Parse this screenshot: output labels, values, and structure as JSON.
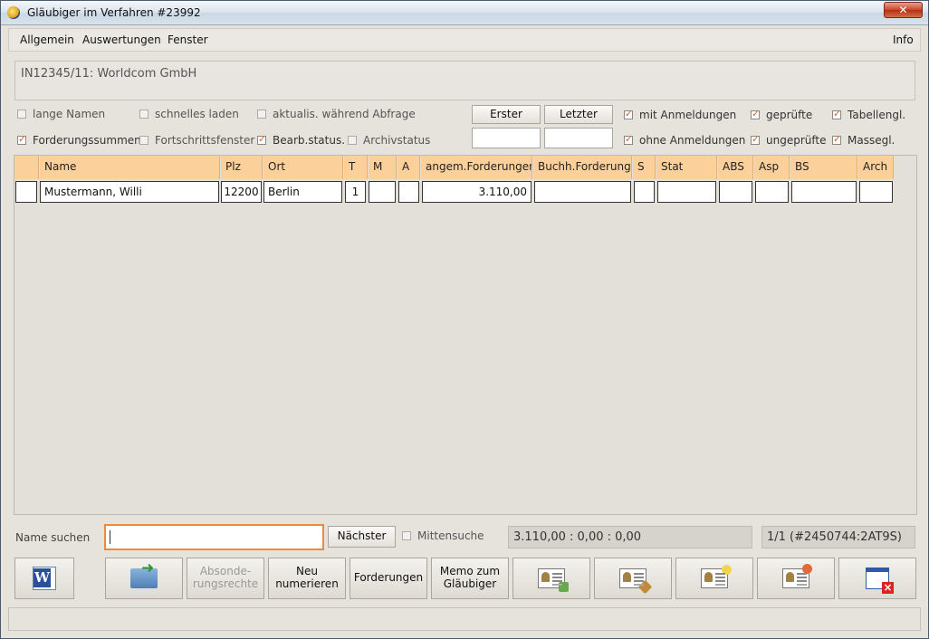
{
  "window": {
    "title": "Gläubiger im Verfahren #23992",
    "close_label": "✕"
  },
  "menu": {
    "allgemein": "Allgemein",
    "auswertungen": "Auswertungen",
    "fenster": "Fenster",
    "info": "Info"
  },
  "case": {
    "text": "IN12345/11: Worldcom GmbH"
  },
  "options": {
    "lange_namen": {
      "label": "lange Namen",
      "checked": false
    },
    "schnelles_laden": {
      "label": "schnelles laden",
      "checked": false
    },
    "aktualis": {
      "label": "aktualis. während Abfrage",
      "checked": false
    },
    "forderungssummen": {
      "label": "Forderungssummen",
      "checked": true
    },
    "fortschrittsfenster": {
      "label": "Fortschrittsfenster",
      "checked": false
    },
    "bearb_status": {
      "label": "Bearb.status.",
      "checked": true
    },
    "archivstatus": {
      "label": "Archivstatus",
      "checked": false
    },
    "mit_anmeldungen": {
      "label": "mit Anmeldungen",
      "checked": true
    },
    "ohne_anmeldungen": {
      "label": "ohne Anmeldungen",
      "checked": true
    },
    "gepruefte": {
      "label": "geprüfte",
      "checked": true
    },
    "ungepruefte": {
      "label": "ungeprüfte",
      "checked": true
    },
    "tabellengl": {
      "label": "Tabellengl.",
      "checked": true
    },
    "massegl": {
      "label": "Massegl.",
      "checked": true
    }
  },
  "nav": {
    "erster": "Erster",
    "letzter": "Letzter",
    "erster_value": "",
    "letzter_value": ""
  },
  "table": {
    "headers": [
      "",
      "Name",
      "Plz",
      "Ort",
      "T",
      "M",
      "A",
      "angem.Forderungen",
      "Buchh.Forderung",
      "S",
      "Stat",
      "ABS",
      "Asp",
      "BS",
      "Arch"
    ],
    "rows": [
      [
        "",
        "Mustermann, Willi",
        "12200",
        "Berlin",
        "1",
        "",
        "",
        "3.110,00",
        "",
        "",
        "",
        "",
        "",
        "",
        ""
      ]
    ]
  },
  "search": {
    "label": "Name suchen",
    "value": "",
    "next_label": "Nächster",
    "mittensuche_label": "Mittensuche",
    "sums": "3.110,00 : 0,00 : 0,00",
    "record": "1/1 (#2450744:2AT9S)"
  },
  "toolbar": {
    "word_icon": "word-icon",
    "export_icon": "folder-export-icon",
    "absonderungsrechte": "Absonde-\nrungsrechte",
    "neu_numerieren": "Neu\nnumerieren",
    "forderungen": "Forderungen",
    "memo": "Memo zum\nGläubiger"
  },
  "colors": {
    "accent": "#fcd09a",
    "focus": "#f08a3a",
    "check": "#e0661c"
  }
}
